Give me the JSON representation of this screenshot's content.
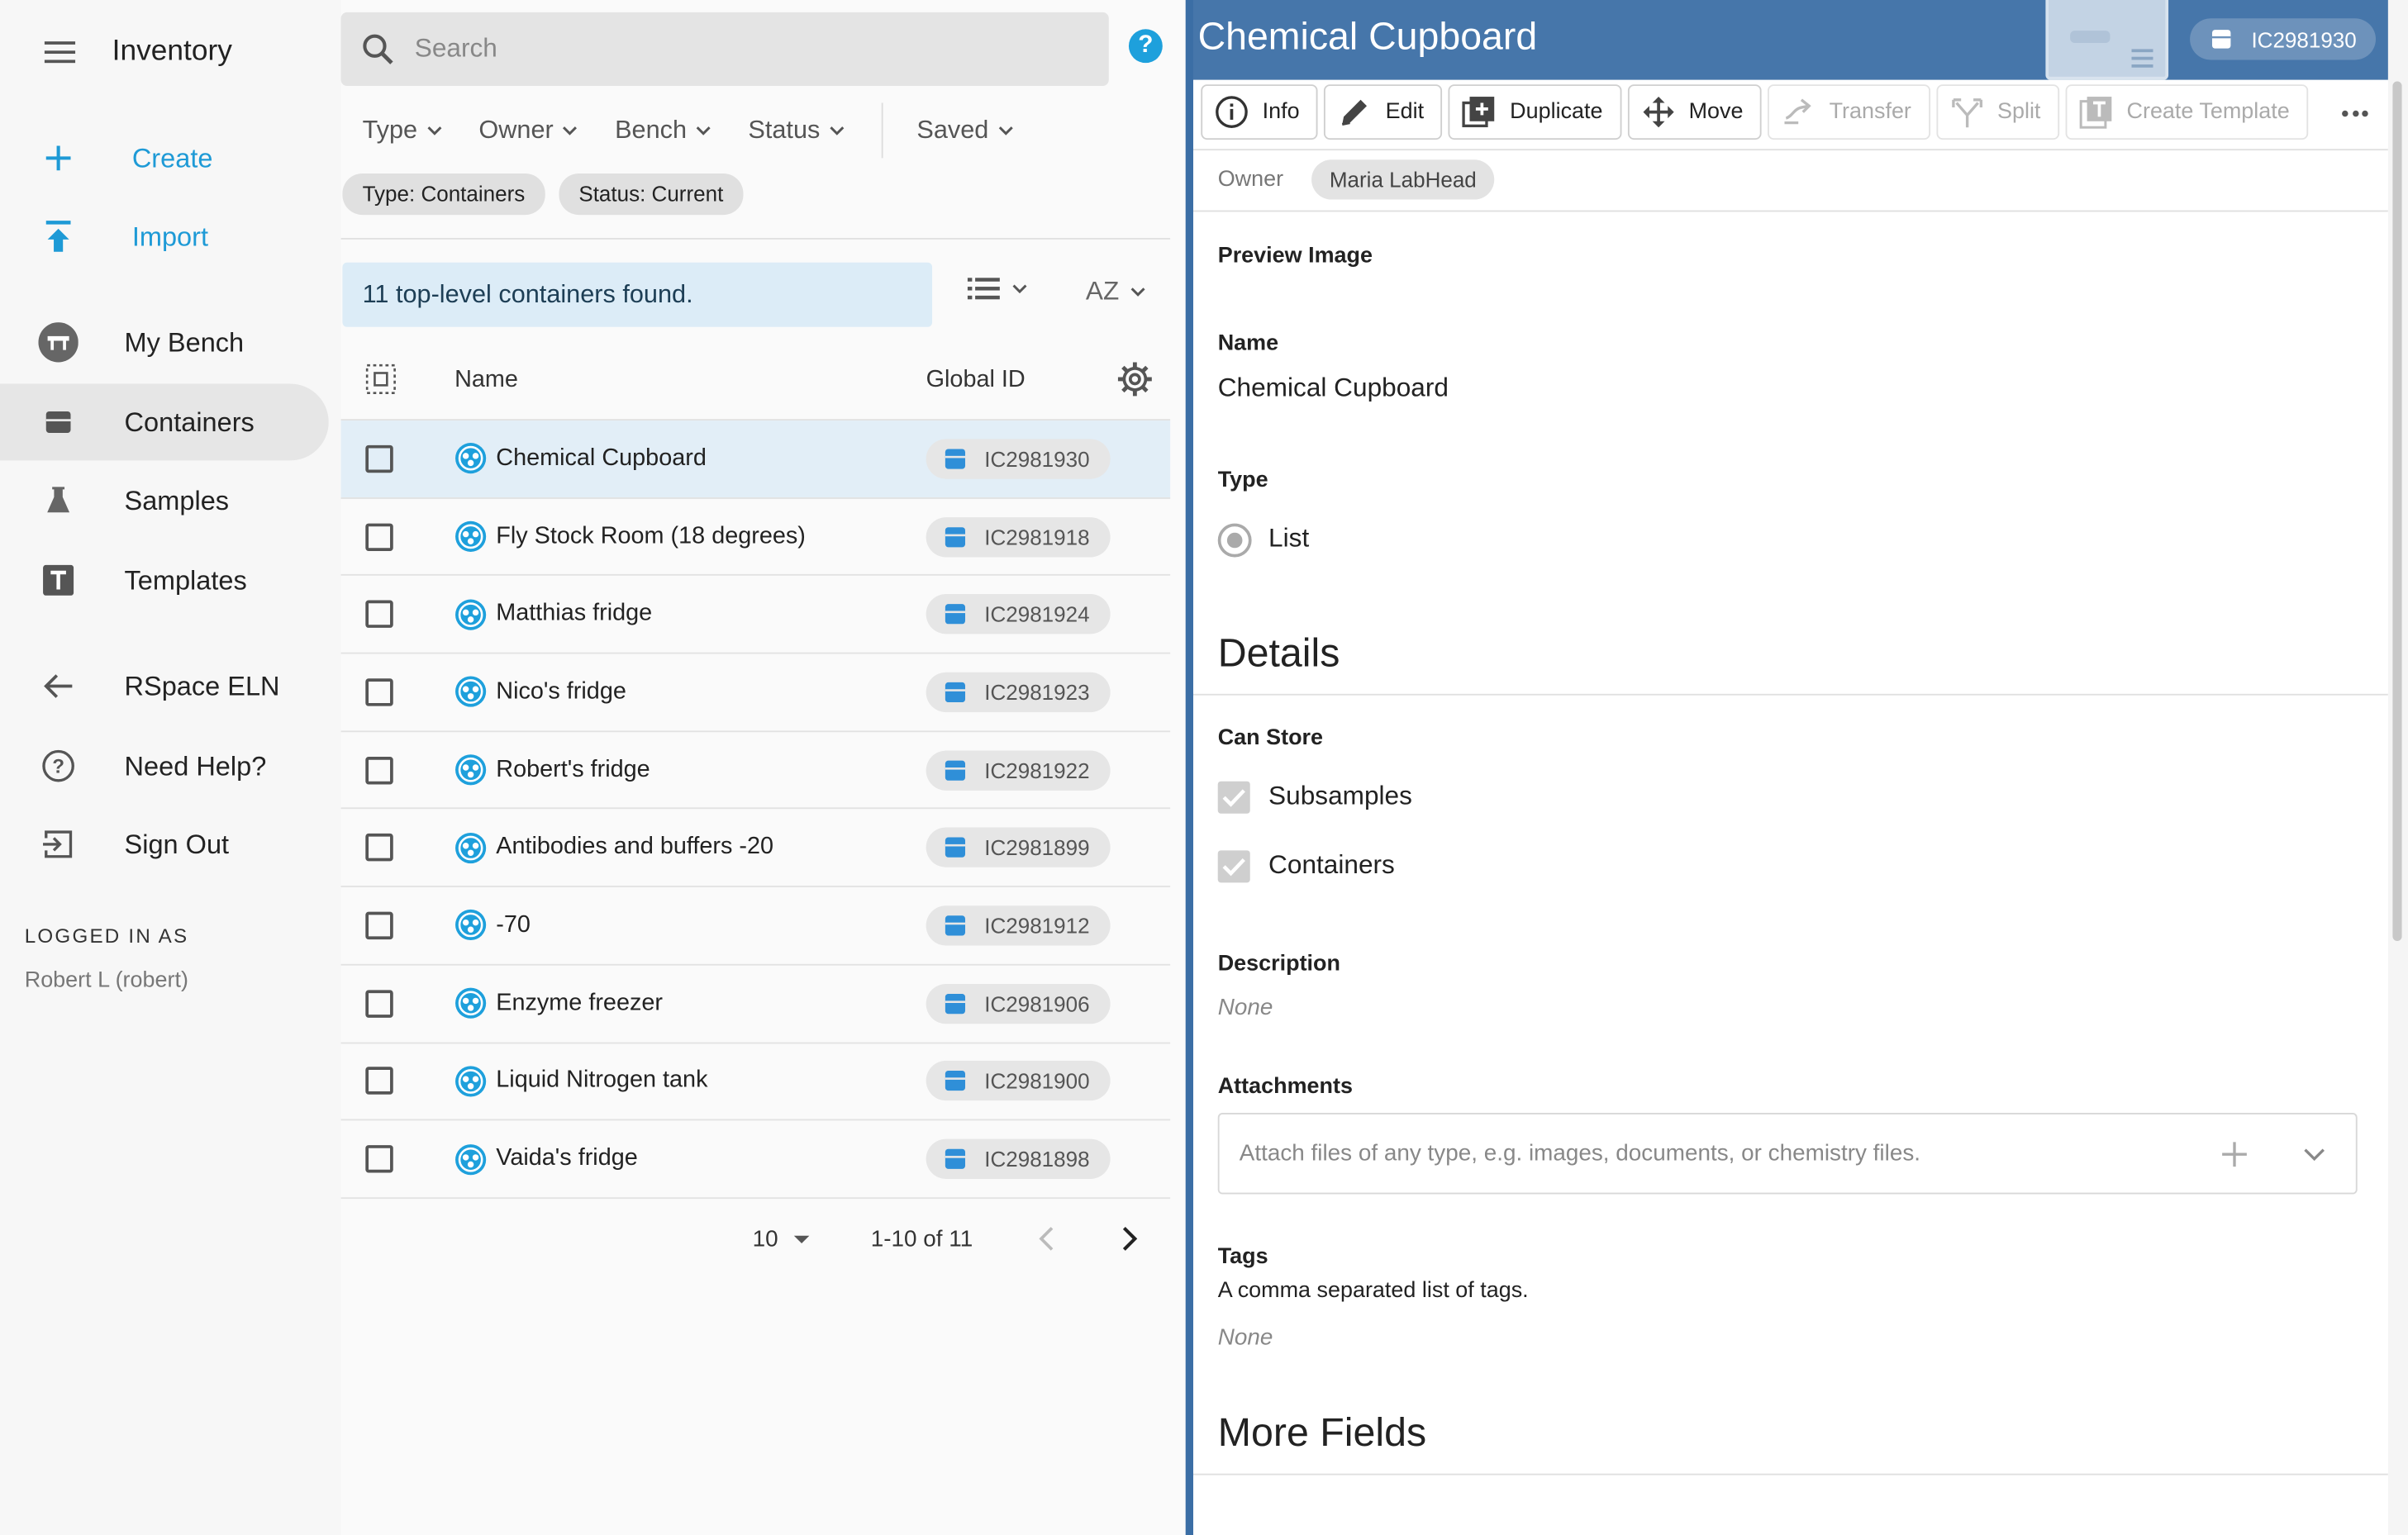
{
  "app": {
    "title": "Inventory"
  },
  "sidebar": {
    "create": "Create",
    "import": "Import",
    "items": [
      {
        "label": "My Bench",
        "icon": "bench-icon"
      },
      {
        "label": "Containers",
        "icon": "box-icon",
        "active": true
      },
      {
        "label": "Samples",
        "icon": "flask-icon"
      },
      {
        "label": "Templates",
        "icon": "template-icon"
      }
    ],
    "links": [
      {
        "label": "RSpace ELN",
        "icon": "arrow-left-icon"
      },
      {
        "label": "Need Help?",
        "icon": "help-circle-icon"
      },
      {
        "label": "Sign Out",
        "icon": "sign-out-icon"
      }
    ],
    "logged_in_label": "LOGGED IN AS",
    "user": "Robert L (robert)"
  },
  "search": {
    "placeholder": "Search"
  },
  "help_icon": "?",
  "filters": [
    "Type",
    "Owner",
    "Bench",
    "Status",
    "Saved"
  ],
  "chips": [
    "Type: Containers",
    "Status: Current"
  ],
  "results_text": "11 top-level containers found.",
  "sort_label": "AZ",
  "table": {
    "headers": {
      "name": "Name",
      "global_id": "Global ID"
    },
    "rows": [
      {
        "name": "Chemical Cupboard",
        "gid": "IC2981930",
        "selected": true
      },
      {
        "name": "Fly Stock Room (18 degrees)",
        "gid": "IC2981918"
      },
      {
        "name": "Matthias fridge",
        "gid": "IC2981924"
      },
      {
        "name": "Nico's fridge",
        "gid": "IC2981923"
      },
      {
        "name": "Robert's fridge",
        "gid": "IC2981922"
      },
      {
        "name": "Antibodies and buffers -20",
        "gid": "IC2981899"
      },
      {
        "name": "-70",
        "gid": "IC2981912"
      },
      {
        "name": "Enzyme freezer",
        "gid": "IC2981906"
      },
      {
        "name": "Liquid Nitrogen tank",
        "gid": "IC2981900"
      },
      {
        "name": "Vaida's fridge",
        "gid": "IC2981898"
      }
    ]
  },
  "pagination": {
    "per_page": "10",
    "range": "1-10 of 11"
  },
  "detail": {
    "title": "Chemical Cupboard",
    "global_id": "IC2981930",
    "toolbar": [
      {
        "label": "Info",
        "icon": "info-icon",
        "enabled": true
      },
      {
        "label": "Edit",
        "icon": "pencil-icon",
        "enabled": true
      },
      {
        "label": "Duplicate",
        "icon": "duplicate-icon",
        "enabled": true
      },
      {
        "label": "Move",
        "icon": "move-icon",
        "enabled": true
      },
      {
        "label": "Transfer",
        "icon": "transfer-icon",
        "enabled": false
      },
      {
        "label": "Split",
        "icon": "split-icon",
        "enabled": false
      },
      {
        "label": "Create Template",
        "icon": "template-icon",
        "enabled": false
      }
    ],
    "owner_label": "Owner",
    "owner": "Maria LabHead",
    "preview_image_label": "Preview Image",
    "name_label": "Name",
    "name": "Chemical Cupboard",
    "type_label": "Type",
    "type_value": "List",
    "details_heading": "Details",
    "can_store_label": "Can Store",
    "can_store": [
      "Subsamples",
      "Containers"
    ],
    "description_label": "Description",
    "description": "None",
    "attachments_label": "Attachments",
    "attachments_placeholder": "Attach files of any type, e.g. images, documents, or chemistry files.",
    "tags_label": "Tags",
    "tags_help": "A comma separated list of tags.",
    "tags": "None",
    "more_fields_heading": "More Fields"
  },
  "colors": {
    "accent": "#1e9ad6",
    "header_blue": "#4676aa",
    "selected_row": "#e2eef7",
    "results_banner": "#dcecf7"
  }
}
